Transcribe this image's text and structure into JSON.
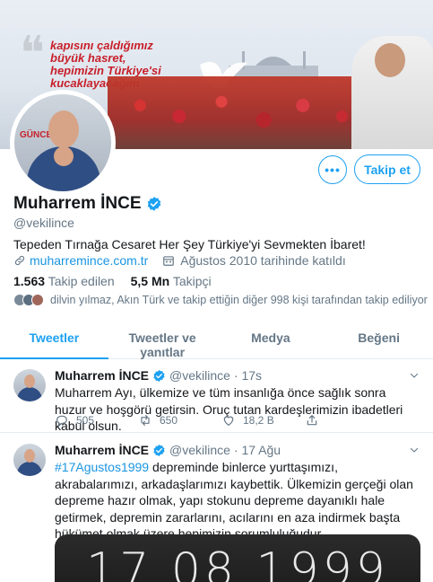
{
  "banner": {
    "slogan_lines": [
      "kapısını çaldığımız",
      "büyük hasret,",
      "hepimizin Türkiye'si",
      "kucaklayacağım"
    ],
    "avatar_caption": "GÜNCE"
  },
  "profile": {
    "name": "Muharrem İNCE",
    "handle": "@vekilince",
    "bio": "Tepeden Tırnağa Cesaret Her Şey Türkiye'yi Sevmekten İbaret!",
    "website": "muharremince.com.tr",
    "joined": "Ağustos 2010 tarihinde katıldı",
    "following_count": "1.563",
    "following_label": "Takip edilen",
    "followers_count": "5,5 Mn",
    "followers_label": "Takipçi",
    "followers_you_know": "dilvin yılmaz, Akın Türk ve takip ettiğin diğer 998 kişi tarafından takip ediliyor"
  },
  "actions": {
    "more_label": "•••",
    "follow_label": "Takip et"
  },
  "tabs": [
    {
      "label": "Tweetler",
      "active": true
    },
    {
      "label": "Tweetler ve yanıtlar",
      "active": false
    },
    {
      "label": "Medya",
      "active": false
    },
    {
      "label": "Beğeni",
      "active": false
    }
  ],
  "tweets": [
    {
      "name": "Muharrem İNCE",
      "handle": "@vekilince",
      "time": "· 17s",
      "text": "Muharrem Ayı, ülkemize ve tüm insanlığa önce sağlık sonra huzur ve hoşgörü getirsin. Oruç tutan kardeşlerimizin ibadetleri kabul olsun.",
      "replies": "505",
      "retweets": "650",
      "likes": "18,2 B"
    },
    {
      "name": "Muharrem İNCE",
      "handle": "@vekilince",
      "time": "· 17 Ağu",
      "hashtag": "#17Agustos1999",
      "text": " depreminde binlerce yurttaşımızı, akrabalarımızı, arkadaşlarımızı kaybettik. Ülkemizin gerçeği olan depreme hazır olmak, yapı stokunu depreme dayanıklı hale getirmek, depremin zararlarını, acılarını en aza indirmek başta hükümet olmak üzere hepimizin sorumluluğudur",
      "media_text": "17.08.1999"
    }
  ],
  "colors": {
    "accent": "#1da1f2",
    "link": "#1b95e0",
    "muted": "#657786",
    "text": "#14171a"
  }
}
